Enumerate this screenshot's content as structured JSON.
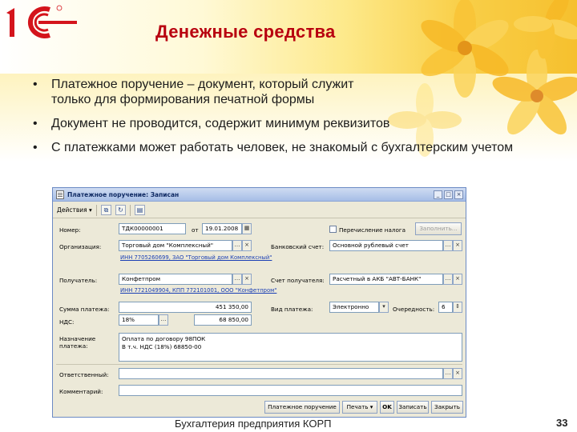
{
  "slide": {
    "title": "Денежные средства",
    "bullets": [
      "Платежное поручение – документ, который служит только для формирования печатной формы",
      "Документ не проводится, содержит минимум реквизитов",
      "С платежками может работать человек, не знакомый с бухгалтерским учетом"
    ],
    "footer": "Бухгалтерия предприятия КОРП",
    "page_number": "33",
    "logo_text": "1C",
    "colors": {
      "title": "#b8000f",
      "logo": "#d4141c",
      "window_border": "#6b8ac4",
      "link": "#1a3fb5"
    }
  },
  "window": {
    "title": "Платежное поручение: Записан",
    "title_buttons": [
      "_",
      "□",
      "×"
    ],
    "toolbar": {
      "actions_label": "Действия",
      "icons": [
        "copy-icon",
        "refresh-icon",
        "structure-icon"
      ]
    },
    "labels": {
      "number": "Номер:",
      "from": "от",
      "organization": "Организация:",
      "recipient": "Получатель:",
      "amount": "Сумма платежа:",
      "vat": "НДС:",
      "purpose": "Назначение платежа:",
      "tax_transfer": "Перечисление налога",
      "bank_account": "Банковский счет:",
      "recipient_account": "Счет получателя:",
      "payment_type": "Вид платежа:",
      "priority": "Очередность:",
      "responsible": "Ответственный:",
      "comment": "Комментарий:"
    },
    "values": {
      "number": "ТДК00000001",
      "date": "19.01.2008",
      "organization": "Торговый дом \"Комплексный\"",
      "organization_inn": "ИНН 7705260699, ЗАО \"Торговый дом Комплексный\"",
      "bank_account": "Основной рублевый счет",
      "recipient": "Конфетпром",
      "recipient_inn": "ИНН 7721049904, КПП 772101001, ООО \"Конфетпром\"",
      "recipient_account": "Расчетный в АКБ \"АВТ-БАНК\"",
      "amount": "451 350,00",
      "payment_type": "Электронно",
      "priority": "6",
      "vat_rate": "18%",
      "vat_amount": "68 850,00",
      "purpose_line1": "Оплата по договору 98ПОК",
      "purpose_line2": "В т.ч. НДС  (18%) 68850-00",
      "responsible": "",
      "comment": "",
      "tax_transfer_checked": false
    },
    "buttons": {
      "fill": "Заполнить...",
      "print_form": "Платежное поручение",
      "print": "Печать",
      "ok": "OK",
      "save": "Записать",
      "close": "Закрыть"
    }
  }
}
